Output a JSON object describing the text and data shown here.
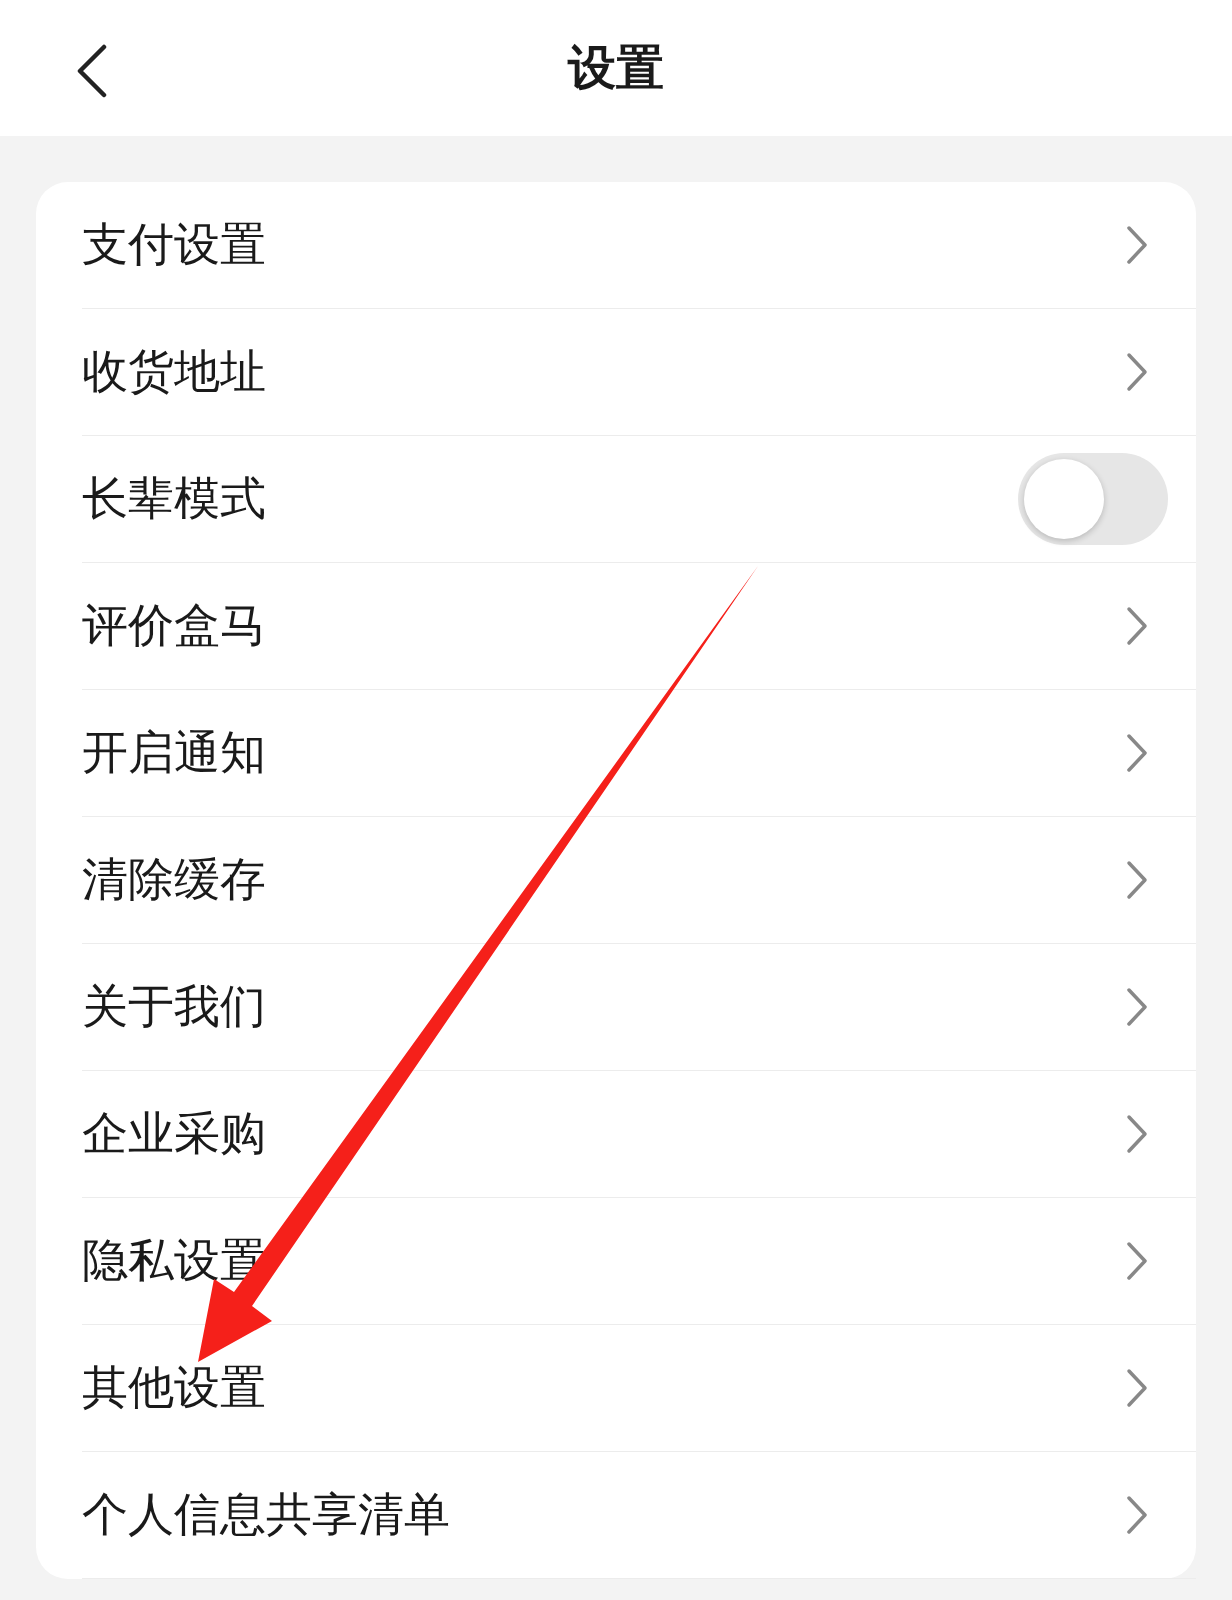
{
  "header": {
    "title": "设置"
  },
  "items": [
    {
      "label": "支付设置",
      "kind": "link"
    },
    {
      "label": "收货地址",
      "kind": "link"
    },
    {
      "label": "长辈模式",
      "kind": "toggle",
      "on": false
    },
    {
      "label": "评价盒马",
      "kind": "link"
    },
    {
      "label": "开启通知",
      "kind": "link"
    },
    {
      "label": "清除缓存",
      "kind": "link"
    },
    {
      "label": "关于我们",
      "kind": "link"
    },
    {
      "label": "企业采购",
      "kind": "link"
    },
    {
      "label": "隐私设置",
      "kind": "link"
    },
    {
      "label": "其他设置",
      "kind": "link"
    },
    {
      "label": "个人信息共享清单",
      "kind": "link"
    }
  ]
}
